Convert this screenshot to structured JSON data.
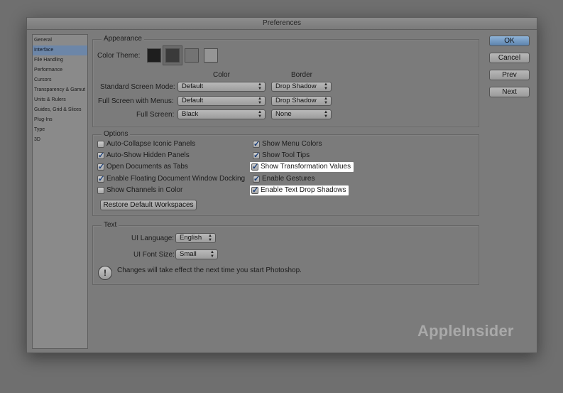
{
  "window": {
    "title": "Preferences"
  },
  "sidebar": {
    "items": [
      {
        "label": "General"
      },
      {
        "label": "Interface"
      },
      {
        "label": "File Handling"
      },
      {
        "label": "Performance"
      },
      {
        "label": "Cursors"
      },
      {
        "label": "Transparency & Gamut"
      },
      {
        "label": "Units & Rulers"
      },
      {
        "label": "Guides, Grid & Slices"
      },
      {
        "label": "Plug-Ins"
      },
      {
        "label": "Type"
      },
      {
        "label": "3D"
      }
    ],
    "selected": "Interface"
  },
  "appearance": {
    "group_title": "Appearance",
    "color_theme_label": "Color Theme:",
    "theme_colors": [
      "#1e1e1e",
      "#3a3a3a",
      "#737373",
      "#959595"
    ],
    "selected_theme_index": 1,
    "color_header": "Color",
    "border_header": "Border",
    "rows": [
      {
        "label": "Standard Screen Mode:",
        "color": "Default",
        "border": "Drop Shadow"
      },
      {
        "label": "Full Screen with Menus:",
        "color": "Default",
        "border": "Drop Shadow"
      },
      {
        "label": "Full Screen:",
        "color": "Black",
        "border": "None"
      }
    ]
  },
  "options": {
    "group_title": "Options",
    "left": [
      {
        "label": "Auto-Collapse Iconic Panels",
        "checked": false
      },
      {
        "label": "Auto-Show Hidden Panels",
        "checked": true
      },
      {
        "label": "Open Documents as Tabs",
        "checked": true
      },
      {
        "label": "Enable Floating Document Window Docking",
        "checked": true
      },
      {
        "label": "Show Channels in Color",
        "checked": false
      }
    ],
    "right": [
      {
        "label": "Show Menu Colors",
        "checked": true,
        "highlighted": false
      },
      {
        "label": "Show Tool Tips",
        "checked": true,
        "highlighted": false
      },
      {
        "label": "Show Transformation Values",
        "checked": true,
        "highlighted": true
      },
      {
        "label": "Enable Gestures",
        "checked": true,
        "highlighted": false
      },
      {
        "label": "Enable Text Drop Shadows",
        "checked": true,
        "highlighted": true
      }
    ],
    "restore_button": "Restore Default Workspaces"
  },
  "text": {
    "group_title": "Text",
    "ui_language_label": "UI Language:",
    "ui_language": "English",
    "ui_font_size_label": "UI Font Size:",
    "ui_font_size": "Small",
    "notice": "Changes will take effect the next time you start Photoshop."
  },
  "buttons": {
    "ok": "OK",
    "cancel": "Cancel",
    "prev": "Prev",
    "next": "Next"
  },
  "watermark": "AppleInsider"
}
